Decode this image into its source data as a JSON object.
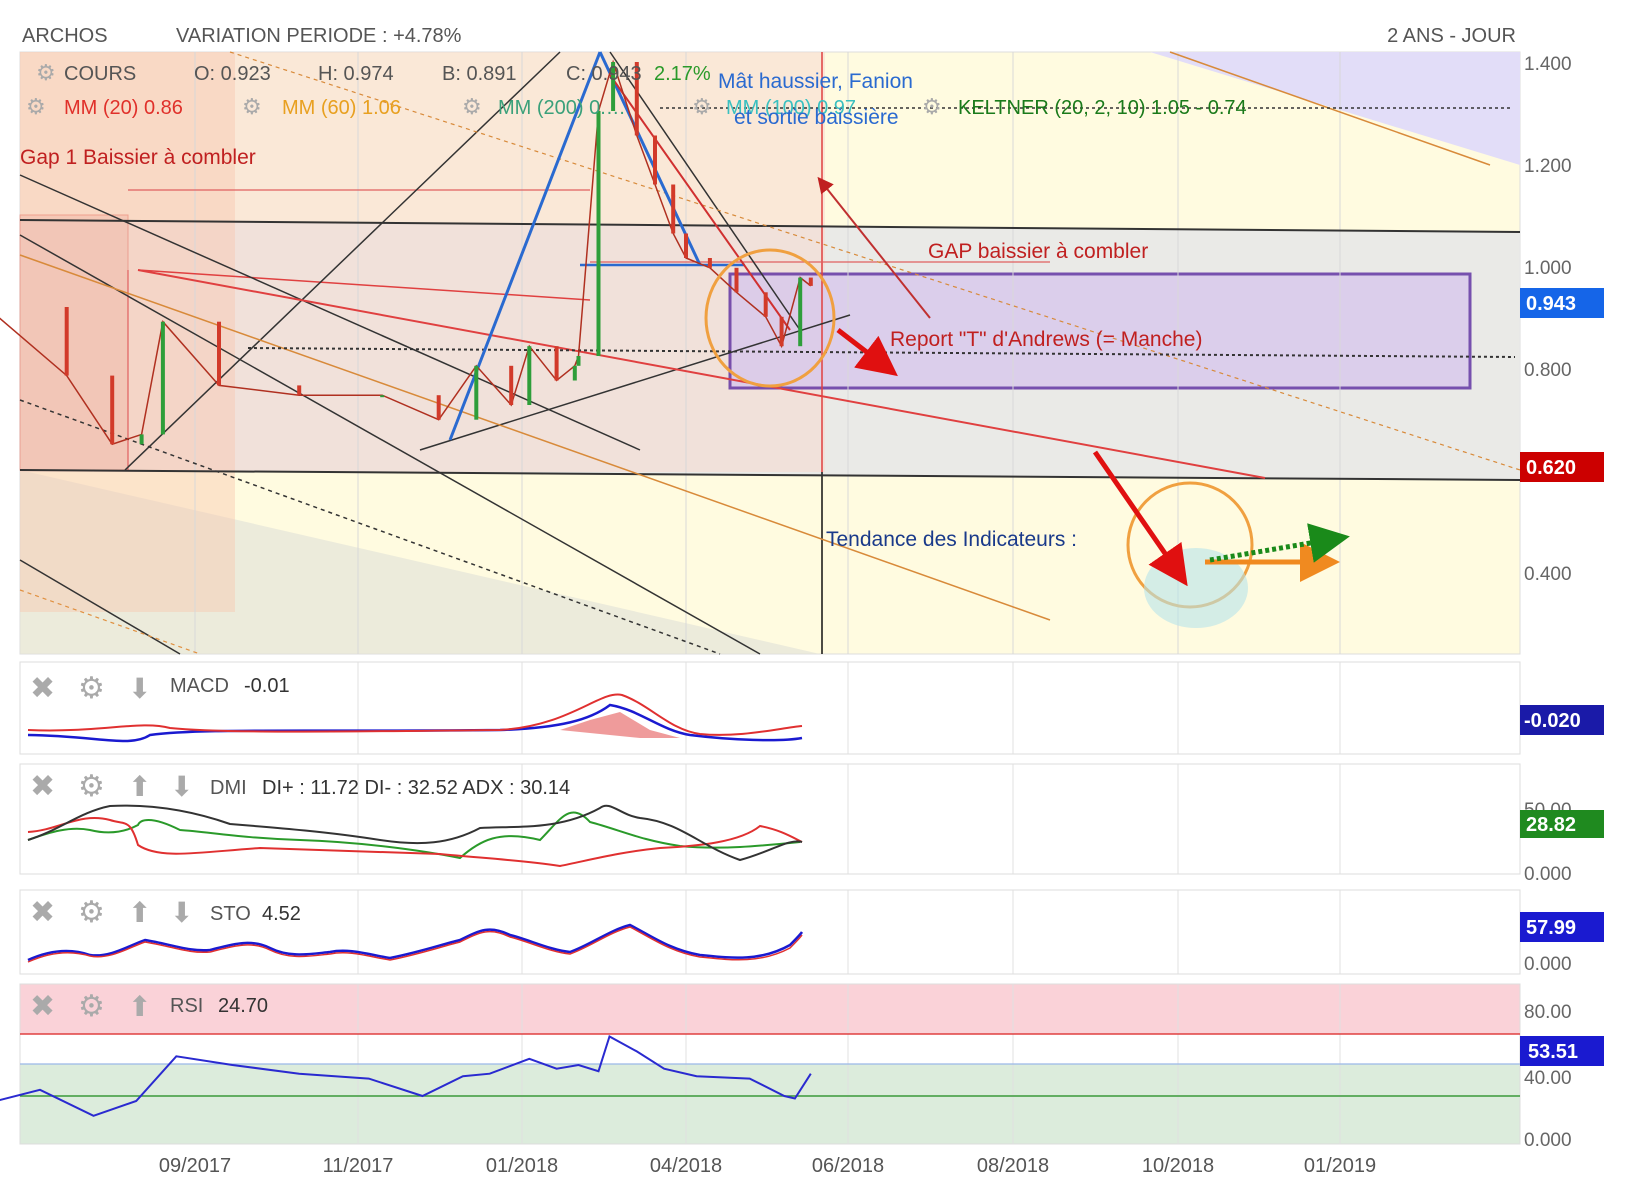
{
  "header": {
    "symbol": "ARCHOS",
    "variation": "VARIATION PERIODE : +4.78%",
    "period": "2 ANS - JOUR"
  },
  "legend": {
    "cours_label": "COURS",
    "ohlc": {
      "o": "O: 0.923",
      "h": "H: 0.974",
      "b": "B: 0.891",
      "c": "C: 0.943",
      "chg": "2.17%"
    },
    "mm20": "MM (20)  0.86",
    "mm60": "MM (60)  1.06",
    "mm200": "MM (200) 0.…",
    "mm100": "MM (100) 0.97",
    "keltner": "KELTNER (20, 2, 10)  1.05 - 0.74"
  },
  "annotations": {
    "gap1": "Gap 1 Baissier à combler",
    "mat": "Mât haussier, Fanion",
    "sortie": "et sortie baissière",
    "gap2": "GAP baissier à combler",
    "report": "Report \"T\" d'Andrews (= Manche)",
    "tendance": "Tendance des Indicateurs :"
  },
  "price_axis": {
    "ticks": [
      "1.400",
      "1.200",
      "1.000",
      "0.800",
      "0.400"
    ],
    "current": "0.943",
    "support": "0.620"
  },
  "x_axis": {
    "ticks": [
      "09/2017",
      "11/2017",
      "01/2018",
      "04/2018",
      "06/2018",
      "08/2018",
      "10/2018",
      "01/2019"
    ]
  },
  "panels": {
    "macd": {
      "label": "MACD",
      "value": "-0.01",
      "badge": "-0.020"
    },
    "dmi": {
      "label": "DMI",
      "value": "DI+ : 11.72 DI- : 32.52 ADX : 30.14",
      "badge": "28.82",
      "ticks": [
        "50.00",
        "0.000"
      ]
    },
    "sto": {
      "label": "STO",
      "value": "4.52",
      "badge": "57.99",
      "ticks": [
        "0.000"
      ]
    },
    "rsi": {
      "label": "RSI",
      "value": "24.70",
      "badge": "53.51",
      "ticks": [
        "80.00",
        "40.00",
        "0.000"
      ]
    }
  },
  "colors": {
    "candle_up": "#2e9e3a",
    "candle_down": "#d23a2a",
    "mm20": "#e0402a",
    "mm60": "#e8a020",
    "mm200": "#3aa07a",
    "keltner": "#2a8a2a",
    "badge_blue": "#1565e8",
    "badge_red": "#cc0000",
    "badge_navy": "#1a1aa8",
    "badge_green": "#1f8a1f"
  },
  "chart_data": {
    "type": "line",
    "title": "ARCHOS",
    "xlabel": "",
    "ylabel": "",
    "ylim": [
      0.25,
      1.45
    ],
    "x": [
      "2017-06-15",
      "2017-07-15",
      "2017-08-01",
      "2017-08-12",
      "2017-08-20",
      "2017-09-10",
      "2017-10-10",
      "2017-11-10",
      "2017-12-01",
      "2017-12-15",
      "2017-12-28",
      "2018-01-05",
      "2018-01-20",
      "2018-01-30",
      "2018-02-01",
      "2018-02-12",
      "2018-02-20",
      "2018-03-05",
      "2018-03-15",
      "2018-03-25",
      "2018-04-01",
      "2018-04-10",
      "2018-04-20",
      "2018-05-01",
      "2018-05-07",
      "2018-05-14",
      "2018-05-18"
    ],
    "series": [
      {
        "name": "COURS",
        "values": [
          0.9,
          0.76,
          0.62,
          0.64,
          0.87,
          0.74,
          0.72,
          0.72,
          0.67,
          0.78,
          0.7,
          0.82,
          0.75,
          0.78,
          0.8,
          1.3,
          1.4,
          1.25,
          1.15,
          1.05,
          1.0,
          0.98,
          0.93,
          0.88,
          0.82,
          0.96,
          0.943
        ]
      }
    ],
    "subcharts": {
      "macd": {
        "last": -0.01
      },
      "dmi": {
        "di_plus": 11.72,
        "di_minus": 32.52,
        "adx": 30.14
      },
      "sto": {
        "last": 4.52
      },
      "rsi": {
        "x": [
          "2017-06-15",
          "2017-07-05",
          "2017-07-25",
          "2017-08-10",
          "2017-08-25",
          "2017-09-15",
          "2017-10-10",
          "2017-11-05",
          "2017-11-25",
          "2017-12-10",
          "2017-12-20",
          "2018-01-05",
          "2018-01-20",
          "2018-02-01",
          "2018-02-12",
          "2018-02-18",
          "2018-03-05",
          "2018-03-20",
          "2018-04-05",
          "2018-04-25",
          "2018-05-08",
          "2018-05-12",
          "2018-05-18"
        ],
        "values": [
          24,
          35,
          14,
          26,
          62,
          55,
          48,
          44,
          30,
          46,
          48,
          60,
          52,
          55,
          50,
          78,
          66,
          52,
          46,
          44,
          30,
          28,
          48
        ]
      }
    }
  }
}
